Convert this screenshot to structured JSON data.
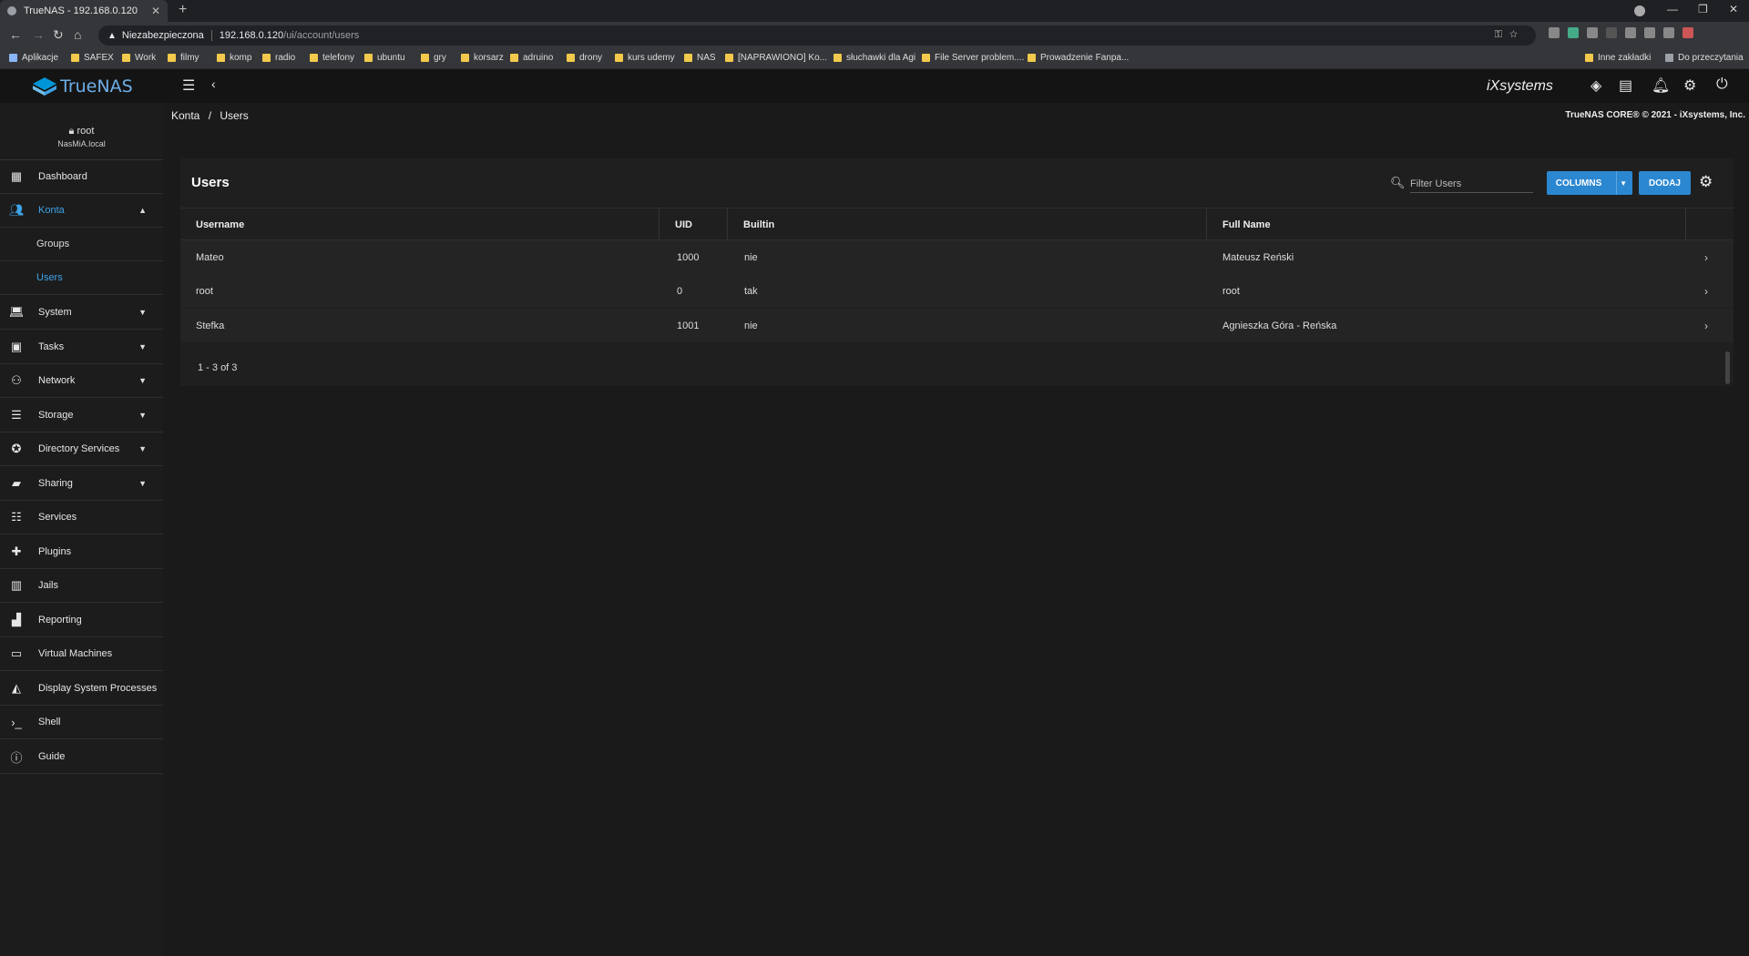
{
  "browser": {
    "tab_title": "TrueNAS - 192.168.0.120",
    "security_label": "Niezabezpieczona",
    "url_host": "192.168.0.120",
    "url_path": "/ui/account/users",
    "bookmarks": [
      "Aplikacje",
      "SAFEX",
      "Work",
      "filmy",
      "komp",
      "radio",
      "telefony",
      "ubuntu",
      "gry",
      "korsarz",
      "adruino",
      "drony",
      "kurs udemy",
      "NAS",
      "[NAPRAWIONO] Ko...",
      "słuchawki dla Agi",
      "File Server problem....",
      "Prowadzenie Fanpa..."
    ],
    "bookmarks_right": [
      "Inne zakładki",
      "Do przeczytania"
    ]
  },
  "app": {
    "logo_text": "TrueNAS",
    "vendor_text": "iXsystems",
    "copyright": "TrueNAS CORE® © 2021 - iXsystems, Inc."
  },
  "user": {
    "name": "root",
    "host": "NasMiA.local"
  },
  "sidebar": {
    "items": [
      {
        "label": "Dashboard",
        "icon": "dashboard-icon"
      },
      {
        "label": "Konta",
        "icon": "accounts-icon"
      },
      {
        "label": "System",
        "icon": "laptop-icon"
      },
      {
        "label": "Tasks",
        "icon": "calendar-icon"
      },
      {
        "label": "Network",
        "icon": "network-icon"
      },
      {
        "label": "Storage",
        "icon": "storage-icon"
      },
      {
        "label": "Directory Services",
        "icon": "directory-icon"
      },
      {
        "label": "Sharing",
        "icon": "folder-share-icon"
      },
      {
        "label": "Services",
        "icon": "tune-icon"
      },
      {
        "label": "Plugins",
        "icon": "puzzle-icon"
      },
      {
        "label": "Jails",
        "icon": "jail-icon"
      },
      {
        "label": "Reporting",
        "icon": "chart-icon"
      },
      {
        "label": "Virtual Machines",
        "icon": "monitor-icon"
      },
      {
        "label": "Display System Processes",
        "icon": "processes-icon"
      },
      {
        "label": "Shell",
        "icon": "terminal-icon"
      },
      {
        "label": "Guide",
        "icon": "info-icon"
      }
    ],
    "konta_sub": [
      "Groups",
      "Users"
    ]
  },
  "breadcrumb": {
    "parent": "Konta",
    "sep": "/",
    "current": "Users"
  },
  "users_card": {
    "title": "Users",
    "filter_placeholder": "Filter Users",
    "columns_button": "COLUMNS",
    "add_button": "DODAJ",
    "headers": [
      "Username",
      "UID",
      "Builtin",
      "Full Name"
    ],
    "rows": [
      {
        "username": "Mateo",
        "uid": "1000",
        "builtin": "nie",
        "full_name": "Mateusz Reński"
      },
      {
        "username": "root",
        "uid": "0",
        "builtin": "tak",
        "full_name": "root"
      },
      {
        "username": "Stefka",
        "uid": "1001",
        "builtin": "nie",
        "full_name": "Agnieszka Góra - Reńska"
      }
    ],
    "pager": "1 - 3 of 3"
  }
}
